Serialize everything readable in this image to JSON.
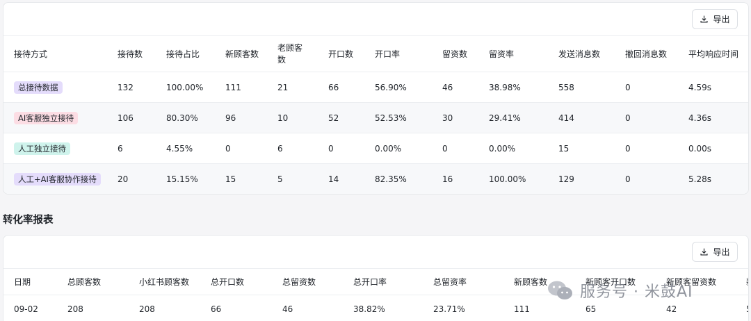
{
  "export_label": "导出",
  "reception_table": {
    "headers": [
      "接待方式",
      "接待数",
      "接待占比",
      "新顾客数",
      "老顾客数",
      "开口数",
      "开口率",
      "留资数",
      "留资率",
      "发送消息数",
      "撤回消息数",
      "平均响应时间"
    ],
    "rows": [
      {
        "tag": "总接待数据",
        "tag_color": "#e4dcfb",
        "values": [
          "132",
          "100.00%",
          "111",
          "21",
          "66",
          "56.90%",
          "46",
          "38.98%",
          "558",
          "0",
          "4.59s"
        ]
      },
      {
        "tag": "AI客服独立接待",
        "tag_color": "#fcdde4",
        "values": [
          "106",
          "80.30%",
          "96",
          "10",
          "52",
          "52.53%",
          "30",
          "29.41%",
          "414",
          "0",
          "4.36s"
        ]
      },
      {
        "tag": "人工独立接待",
        "tag_color": "#cff3ec",
        "values": [
          "6",
          "4.55%",
          "0",
          "6",
          "0",
          "0.00%",
          "0",
          "0.00%",
          "15",
          "0",
          "0.00s"
        ]
      },
      {
        "tag": "人工+AI客服协作接待",
        "tag_color": "#e4dcfb",
        "values": [
          "20",
          "15.15%",
          "15",
          "5",
          "14",
          "82.35%",
          "16",
          "100.00%",
          "129",
          "0",
          "5.28s"
        ]
      }
    ]
  },
  "conversion_section_title": "转化率报表",
  "conversion_table": {
    "headers": [
      "日期",
      "总顾客数",
      "小红书顾客数",
      "总开口数",
      "总留资数",
      "总开口率",
      "总留资率",
      "新顾客数",
      "新顾客开口数",
      "新顾客留资数",
      "新"
    ],
    "rows": [
      [
        "09-02",
        "208",
        "208",
        "66",
        "46",
        "38.82%",
        "23.71%",
        "111",
        "65",
        "42",
        "5"
      ]
    ]
  },
  "watermark_text": "服务号 · 米鼓AI"
}
